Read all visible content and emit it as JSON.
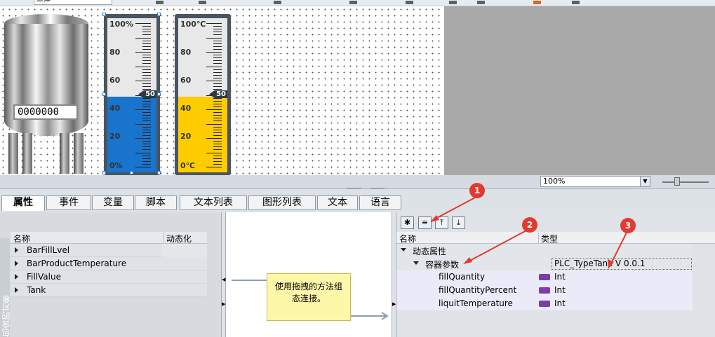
{
  "toolbar": {
    "font_name": "宋体"
  },
  "tank": {
    "display_value": "0000000"
  },
  "gauge_percent": {
    "labels": [
      "100%",
      "80",
      "60",
      "40",
      "20",
      "0%"
    ],
    "marker_value": "50",
    "fill_level": 0.5,
    "fill_color": "#1874cd"
  },
  "gauge_temp": {
    "labels": [
      "100℃",
      "80",
      "60",
      "40",
      "20",
      "0℃"
    ],
    "marker_value": "50",
    "fill_level": 0.5,
    "fill_color": "#ffcc00"
  },
  "zoom": {
    "value": "100%"
  },
  "tabs": [
    "属性",
    "事件",
    "变量",
    "脚本",
    "文本列表",
    "图形列表",
    "文本",
    "语言"
  ],
  "left_panel": {
    "side_label": "包含的对象",
    "columns": [
      "名称",
      "动态化"
    ],
    "rows": [
      "BarFillLvel",
      "BarProductTemperature",
      "FillValue",
      "Tank"
    ]
  },
  "note": {
    "text": "使用拖拽的方法组态连接。"
  },
  "right_panel": {
    "columns": [
      "名称",
      "类型"
    ],
    "group": "动态属性",
    "subgroup": "容器参数",
    "subgroup_type": "PLC_TypeTank V 0.0.1",
    "params": [
      {
        "name": "fillQuantity",
        "type": "Int"
      },
      {
        "name": "fillQuantityPercent",
        "type": "Int"
      },
      {
        "name": "liquitTemperature",
        "type": "Int"
      }
    ]
  },
  "callouts": [
    "1",
    "2",
    "3"
  ]
}
